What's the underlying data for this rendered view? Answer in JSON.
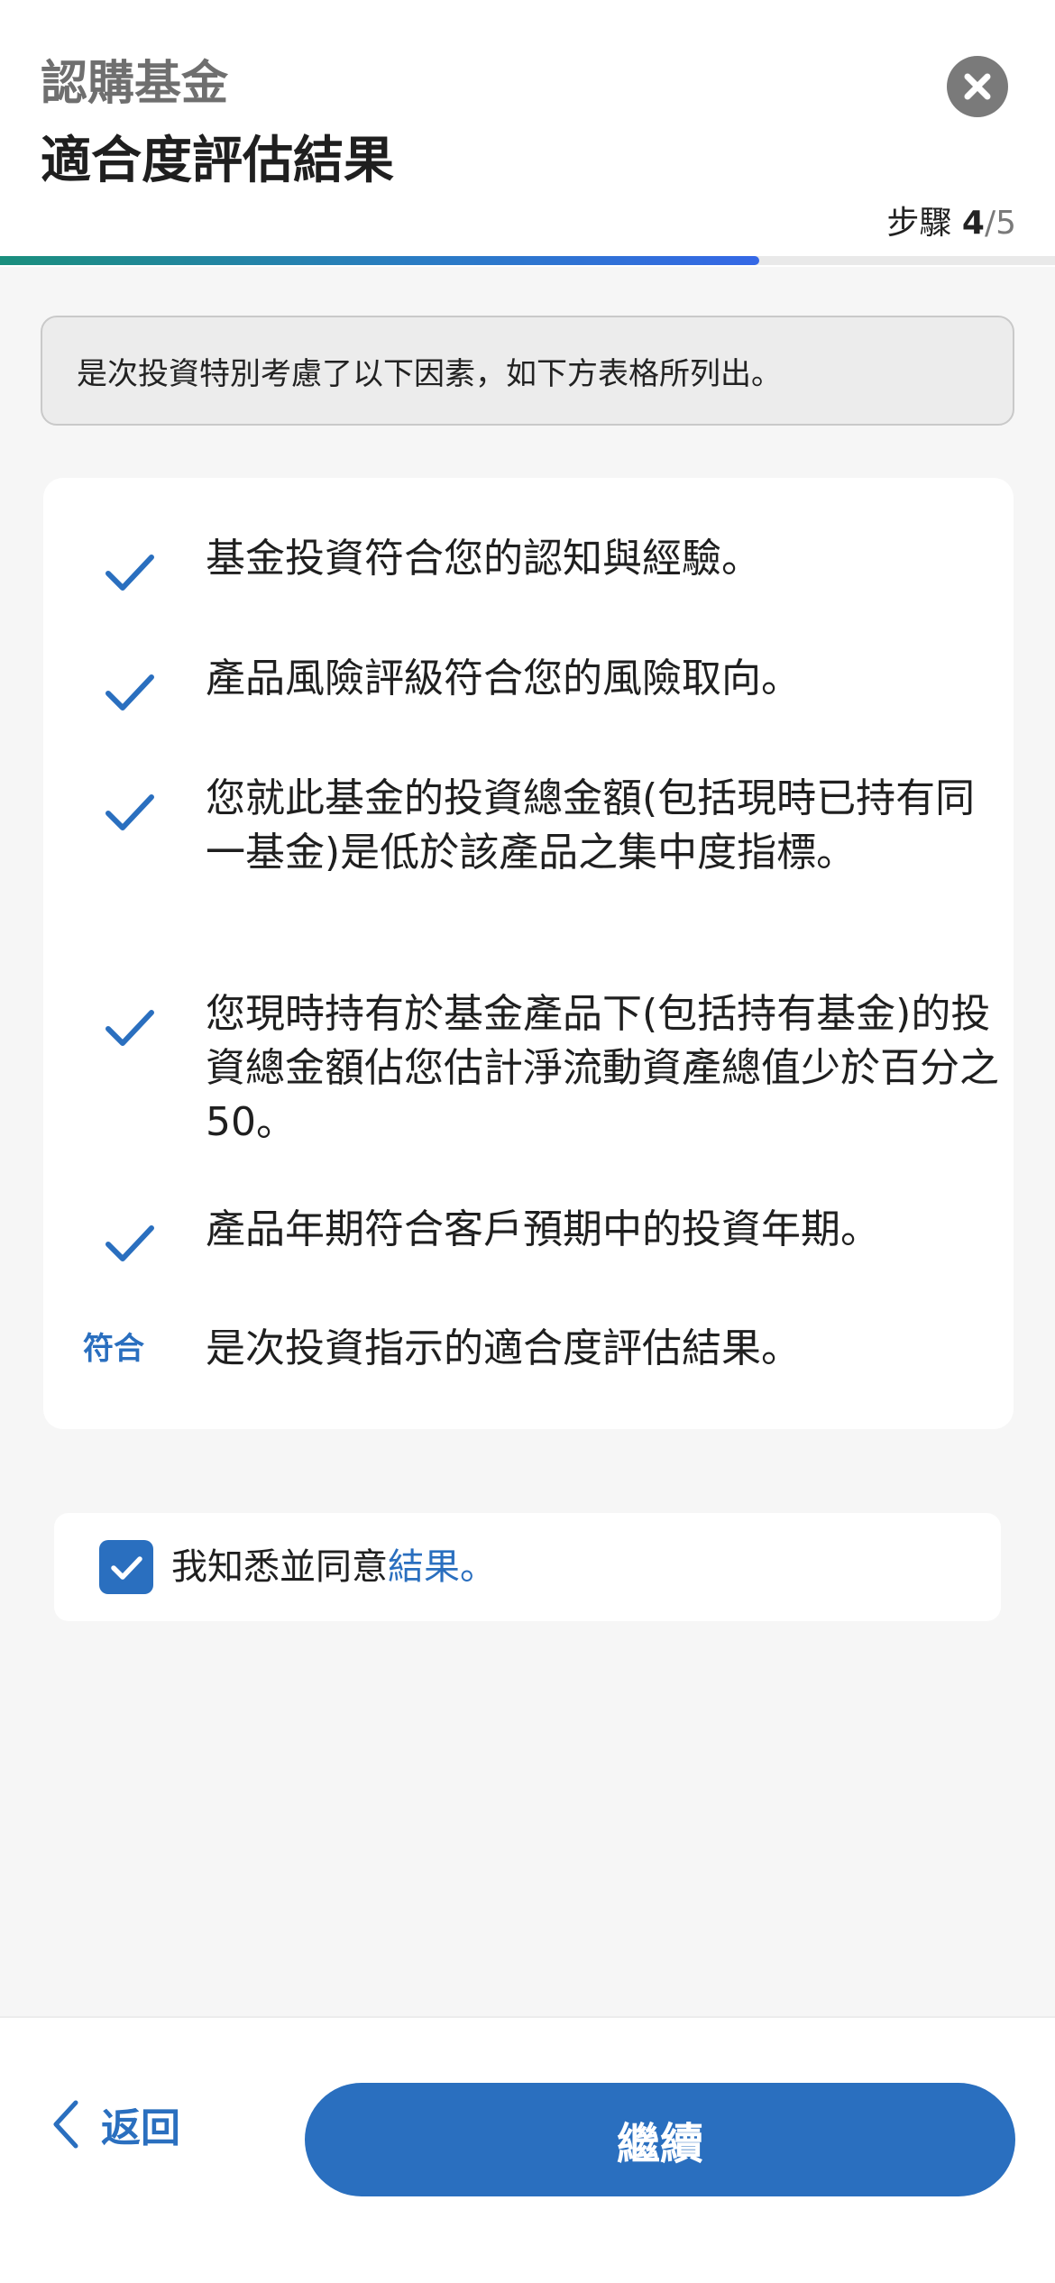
{
  "header": {
    "eyebrow": "認購基金",
    "title": "適合度評估結果",
    "step_label": "步驟",
    "step_current": "4",
    "step_total": "/5",
    "progress": 0.8
  },
  "notice": "是次投資特別考慮了以下因素，如下方表格所列出。",
  "criteria": [
    {
      "icon": "check-icon",
      "text": "基金投資符合您的認知與經驗。"
    },
    {
      "icon": "check-icon",
      "text": "產品風險評級符合您的風險取向。"
    },
    {
      "icon": "check-icon",
      "text": "您就此基金的投資總金額(包括現時已持有同一基金)是低於該產品之集中度指標。"
    },
    {
      "icon": "check-icon",
      "text": "您現時持有於基金產品下(包括持有基金)的投資總金額佔您估計淨流動資產總值少於百分之50。"
    },
    {
      "icon": "check-icon",
      "text": "產品年期符合客戶預期中的投資年期。"
    }
  ],
  "result": {
    "tag": "符合",
    "text": "是次投資指示的適合度評估結果。"
  },
  "agreement": {
    "text": "我知悉並同意",
    "link": "結果。",
    "checked": true
  },
  "footer": {
    "back_label": "返回",
    "continue_label": "繼續"
  },
  "colors": {
    "accent": "#2a6fbf",
    "check": "#2a6fbf"
  }
}
